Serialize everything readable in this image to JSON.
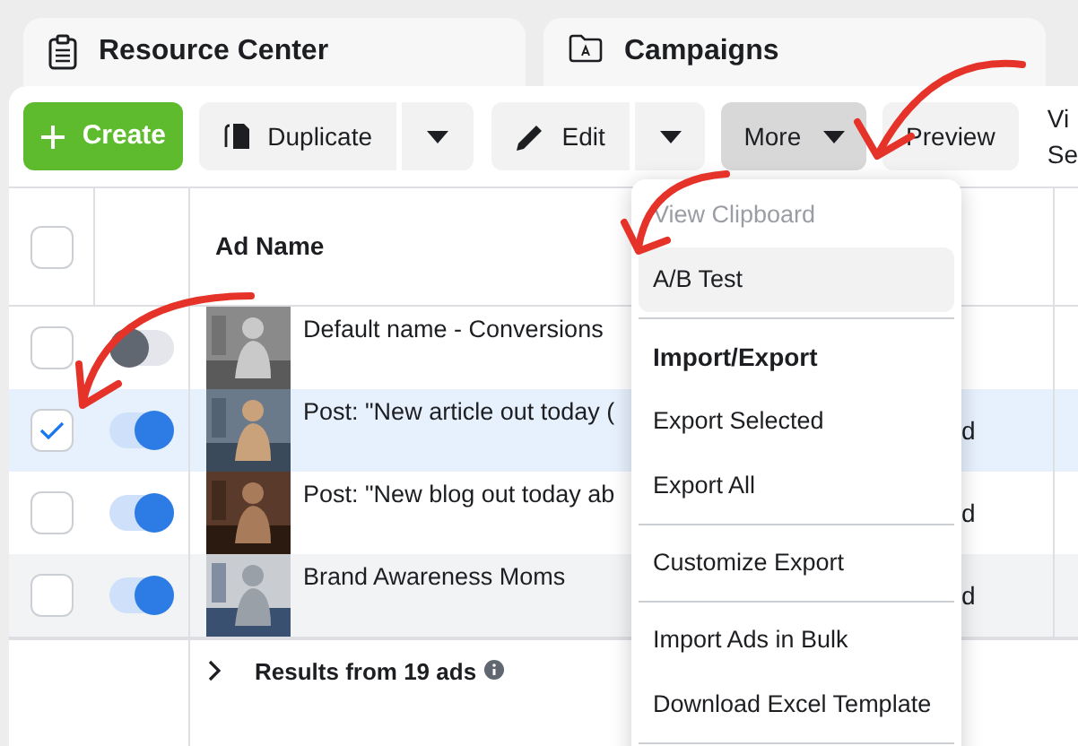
{
  "top_cards": [
    {
      "title": "Resource Center"
    },
    {
      "title": "Campaigns"
    }
  ],
  "toolbar": {
    "create": "Create",
    "duplicate": "Duplicate",
    "edit": "Edit",
    "more": {
      "label": "More",
      "open": true
    },
    "preview": "Preview",
    "cut_label": [
      "Vi",
      "Se"
    ]
  },
  "table": {
    "header": {
      "checked": false,
      "column_3": "Ad Name"
    },
    "rows": [
      {
        "checked": false,
        "on": false,
        "selected": false,
        "name": "Default name - Conversions"
      },
      {
        "checked": true,
        "on": true,
        "selected": true,
        "name": "Post: \"New article out today (",
        "column_4": "d"
      },
      {
        "checked": false,
        "on": true,
        "selected": false,
        "name": "Post: \"New blog out today ab",
        "column_4": "d"
      },
      {
        "checked": false,
        "on": true,
        "selected": false,
        "hovered": true,
        "name": "Brand Awareness Moms",
        "column_4": "d"
      }
    ],
    "footer": "Results from 19 ads"
  },
  "menu": {
    "items": [
      {
        "kind": "item",
        "label": "View Clipboard",
        "disabled": true,
        "selected": false
      },
      {
        "kind": "item",
        "label": "A/B Test",
        "disabled": false,
        "selected": true
      },
      {
        "kind": "divider"
      },
      {
        "kind": "header",
        "label": "Import/Export"
      },
      {
        "kind": "item",
        "label": "Export Selected",
        "disabled": false,
        "selected": false
      },
      {
        "kind": "item",
        "label": "Export All",
        "disabled": false,
        "selected": false
      },
      {
        "kind": "divider"
      },
      {
        "kind": "item",
        "label": "Customize Export",
        "disabled": false,
        "selected": false
      },
      {
        "kind": "divider"
      },
      {
        "kind": "item",
        "label": "Import Ads in Bulk",
        "disabled": false,
        "selected": false
      },
      {
        "kind": "item",
        "label": "Download Excel Template",
        "disabled": false,
        "selected": false
      },
      {
        "kind": "divider"
      }
    ]
  }
}
